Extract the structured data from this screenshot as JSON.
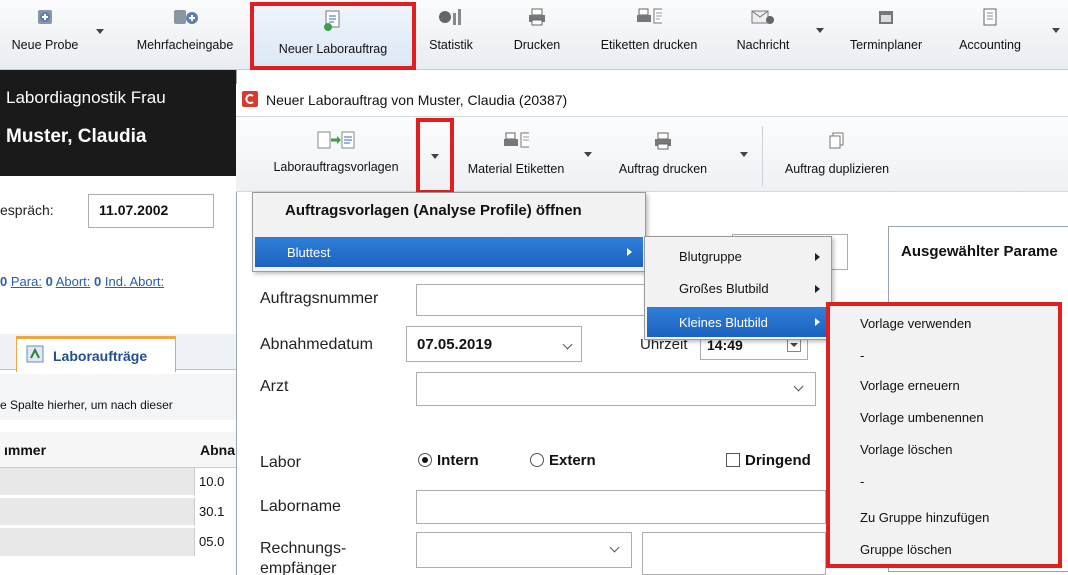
{
  "toolbar": {
    "items": [
      {
        "label": "Neue Probe",
        "icon": "new-sample-icon"
      },
      {
        "label": "Mehrfacheingabe",
        "icon": "multi-entry-icon"
      },
      {
        "label": "Neuer Laborauftrag",
        "icon": "lab-order-icon"
      },
      {
        "label": "Statistik",
        "icon": "statistics-icon"
      },
      {
        "label": "Drucken",
        "icon": "printer-icon"
      },
      {
        "label": "Etiketten drucken",
        "icon": "label-printer-icon"
      },
      {
        "label": "Nachricht",
        "icon": "message-icon"
      },
      {
        "label": "Terminplaner",
        "icon": "calendar-icon"
      },
      {
        "label": "Accounting",
        "icon": "accounting-icon"
      }
    ]
  },
  "left": {
    "practice": "Labordiagnostik Frau",
    "patient": "Muster, Claudia",
    "gespraech_label": "espräch:",
    "gespraech_value": "11.07.2002",
    "counts_para_value": "0",
    "counts_para_label": "Para:",
    "counts_abort_value": "0",
    "counts_abort_label": "Abort:",
    "counts_ind_value": "0",
    "counts_ind_label": "Ind. Abort:",
    "tab_label": "Laboraufträge",
    "group_hint": "e Spalte hierher, um nach dieser",
    "col_nummer": "ımmer",
    "col_abn": "Abna",
    "rows": [
      "10.0",
      "30.1",
      "05.0"
    ]
  },
  "dialog": {
    "title": "Neuer Laborauftrag von Muster, Claudia (20387)",
    "toolbar": {
      "vorlagen": "Laborauftragsvorlagen",
      "material": "Material Etiketten",
      "drucken": "Auftrag drucken",
      "duplizieren": "Auftrag duplizieren"
    },
    "form": {
      "auftragsnummer_label": "Auftragsnummer",
      "abnahmedatum_label": "Abnahmedatum",
      "abnahmedatum_value": "07.05.2019",
      "uhrzeit_label": "Uhrzeit",
      "uhrzeit_value": "14:49",
      "arzt_label": "Arzt",
      "labor_label": "Labor",
      "intern": "Intern",
      "extern": "Extern",
      "dringend": "Dringend",
      "laborname_label": "Laborname",
      "rechnung_label1": "Rechnungs-",
      "rechnung_label2": "empfänger",
      "param_title": "Ausgewählter Parame"
    }
  },
  "menu1": {
    "items": [
      "Auftragsvorlagen (Analyse Profile) öffnen",
      "Bluttest"
    ]
  },
  "menu2": {
    "items": [
      "Blutgruppe",
      "Großes Blutbild",
      "Kleines Blutbild"
    ]
  },
  "menu3": {
    "items": [
      "Vorlage verwenden",
      "-",
      "Vorlage erneuern",
      "Vorlage umbenennen",
      "Vorlage löschen",
      "-",
      "Zu Gruppe hinzufügen",
      "Gruppe löschen"
    ]
  },
  "colors": {
    "highlight": "#e02020",
    "selection": "#1c63c0",
    "panel_dark": "#1a1a1a"
  }
}
